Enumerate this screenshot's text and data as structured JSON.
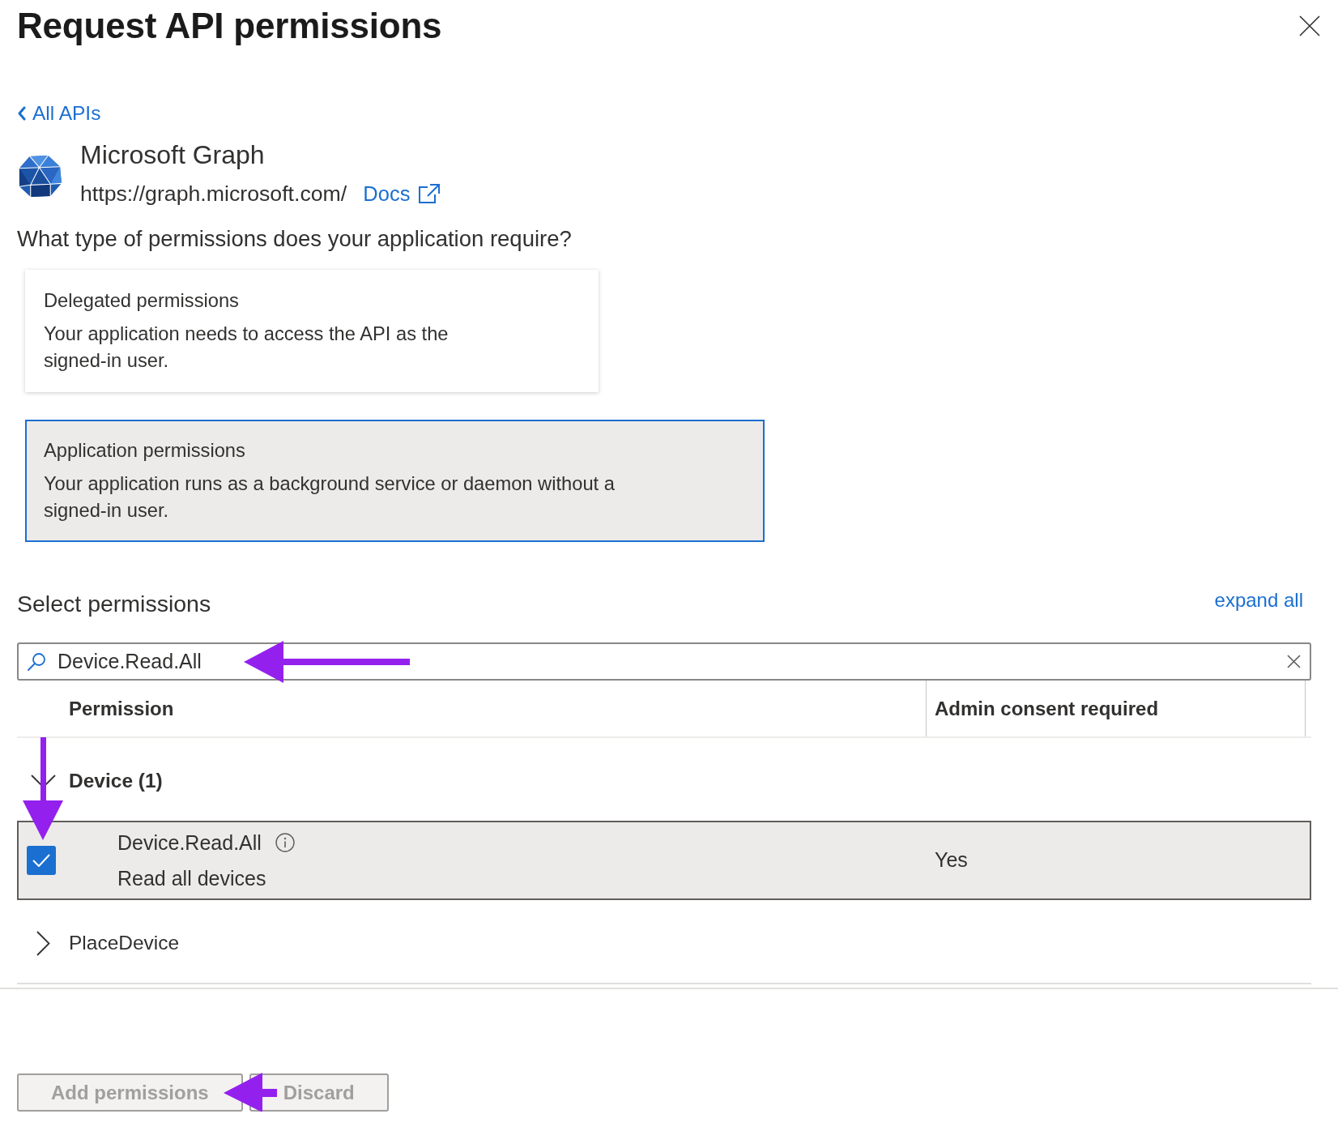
{
  "panel": {
    "title": "Request API permissions"
  },
  "back_link": {
    "label": "All APIs"
  },
  "api": {
    "name": "Microsoft Graph",
    "url": "https://graph.microsoft.com/",
    "docs_link": "Docs"
  },
  "question": "What type of permissions does your application require?",
  "permission_types": [
    {
      "title": "Delegated permissions",
      "description_lines": [
        "Your application needs to access the API as the",
        "signed-in user."
      ],
      "selected": false
    },
    {
      "title": "Application permissions",
      "description_lines": [
        "Your application runs as a background service or daemon without a",
        "signed-in user."
      ],
      "selected": true
    }
  ],
  "select_permissions": {
    "heading": "Select permissions",
    "expand_all": "expand all",
    "search": {
      "value": "Device.Read.All"
    },
    "columns": [
      "Permission",
      "Admin consent required"
    ],
    "groups": [
      {
        "name": "Device (1)",
        "expanded": true,
        "permissions": [
          {
            "name": "Device.Read.All",
            "description": "Read all devices",
            "admin_consent_required": "Yes",
            "checked": true
          }
        ]
      },
      {
        "name": "PlaceDevice",
        "expanded": false
      }
    ]
  },
  "buttons": [
    {
      "label": "Add permissions",
      "disabled": true
    },
    {
      "label": "Discard",
      "disabled": true
    }
  ]
}
